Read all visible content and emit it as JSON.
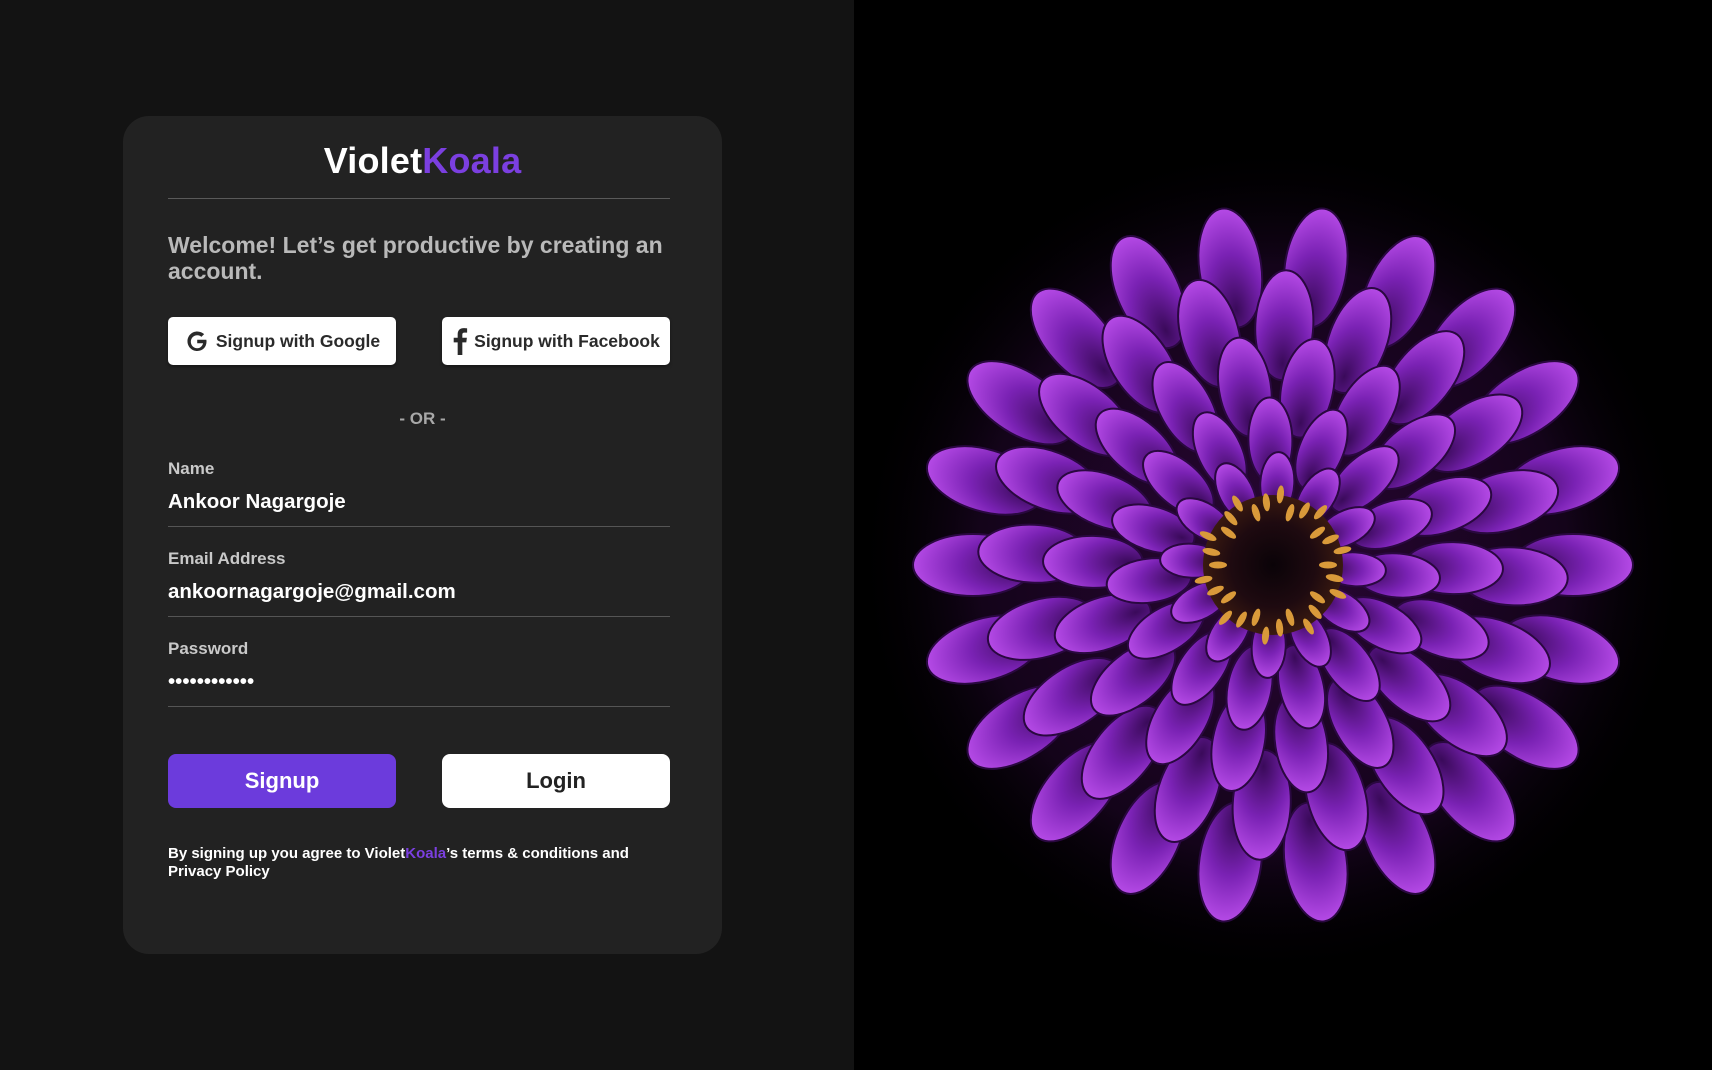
{
  "brand": {
    "name_part1": "Violet",
    "name_part2": "Koala",
    "accent_color": "#7b3fe0"
  },
  "welcome_text": "Welcome! Let’s get productive by creating an account.",
  "social": {
    "google_label": "Signup with Google",
    "google_icon": "google-icon",
    "facebook_label": "Signup with Facebook",
    "facebook_icon": "facebook-icon"
  },
  "divider_text": "- OR -",
  "form": {
    "name": {
      "label": "Name",
      "value": "Ankoor Nagargoje"
    },
    "email": {
      "label": "Email Address",
      "value": "ankoornagargoje@gmail.com"
    },
    "password": {
      "label": "Password",
      "value": "••••••••••••"
    }
  },
  "actions": {
    "signup_label": "Signup",
    "login_label": "Login"
  },
  "terms": {
    "prefix": "By signing up you agree to Violet",
    "brand_highlight": "Koala",
    "suffix": "’s terms & conditions and Privacy Policy"
  },
  "hero_image": {
    "subject": "purple-flower"
  }
}
